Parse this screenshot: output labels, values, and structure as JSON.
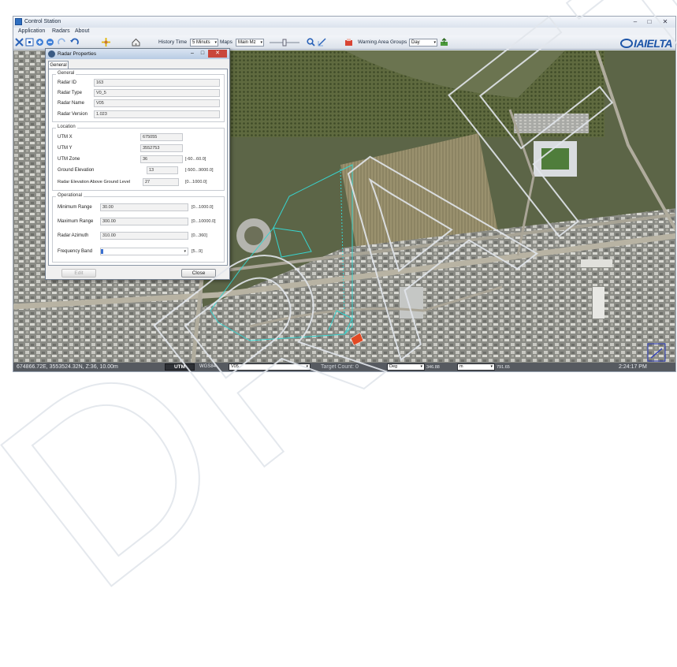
{
  "window": {
    "title": "Control Station",
    "controls": {
      "minimize": "–",
      "maximize": "□",
      "close": "✕"
    }
  },
  "menu": [
    "Application",
    "Radars",
    "About"
  ],
  "toolbar": {
    "history_label": "History Time",
    "history_value": "5 Minuts",
    "maps_label": "Maps",
    "maps_value": "Main Mz",
    "warning_label": "Warning Area Groups",
    "warning_value": "Day",
    "icons": [
      "pan-icon",
      "select-icon",
      "zoom-in-icon",
      "zoom-out-icon",
      "redo-icon",
      "undo-icon",
      "crosshair-icon",
      "home-icon",
      "zoom-slider",
      "search-icon",
      "measure-icon",
      "warning-icon",
      "export-icon"
    ]
  },
  "logo": {
    "text": "IAIELTA",
    "brand_color": "#1d55a8"
  },
  "dialog": {
    "title": "Radar Properties",
    "tab": "General",
    "general": {
      "legend": "General",
      "radar_id_label": "Radar ID",
      "radar_id": "163",
      "radar_type_label": "Radar Type",
      "radar_type": "V0_5",
      "radar_name_label": "Radar Name",
      "radar_name": "V05",
      "radar_version_label": "Radar Version",
      "radar_version": "1.023"
    },
    "location": {
      "legend": "Location",
      "utm_x_label": "UTM X",
      "utm_x": "675055",
      "utm_y_label": "UTM Y",
      "utm_y": "3552753",
      "utm_zone_label": "UTM Zone",
      "utm_zone": "36",
      "utm_zone_range": "[-60...60.0]",
      "ground_elev_label": "Ground Elevation",
      "ground_elev": "13",
      "ground_elev_range": "[-500...9000.0]",
      "radar_elev_label": "Radar Elevation Above Ground Level",
      "radar_elev": "27",
      "radar_elev_range": "[0...1000.0]"
    },
    "operational": {
      "legend": "Operational",
      "min_range_label": "Minimum Range",
      "min_range": "30.00",
      "min_range_range": "[0...1000.0]",
      "max_range_label": "Maximum Range",
      "max_range": "300.00",
      "max_range_range": "[0...10000.0]",
      "azimuth_label": "Radar Azimuth",
      "azimuth": "310.00",
      "azimuth_range": "[0...360]",
      "freq_label": "Frequency Band",
      "freq_range": "[5...9]"
    },
    "edit_label": "Edit",
    "close_label": "Close"
  },
  "status": {
    "coords": "674866.72E, 3553524.32N, Z:36, 10.00m",
    "utm_button": "UTM",
    "datum": "WGS84",
    "radar_select": "V05",
    "target_count": "Target Count: 0",
    "angle_unit": "Deg",
    "angle_value": "346.88",
    "dist_unit": "m",
    "dist_value": "791.65",
    "time": "2:24:17 PM"
  },
  "watermark_text": "DRAFT"
}
